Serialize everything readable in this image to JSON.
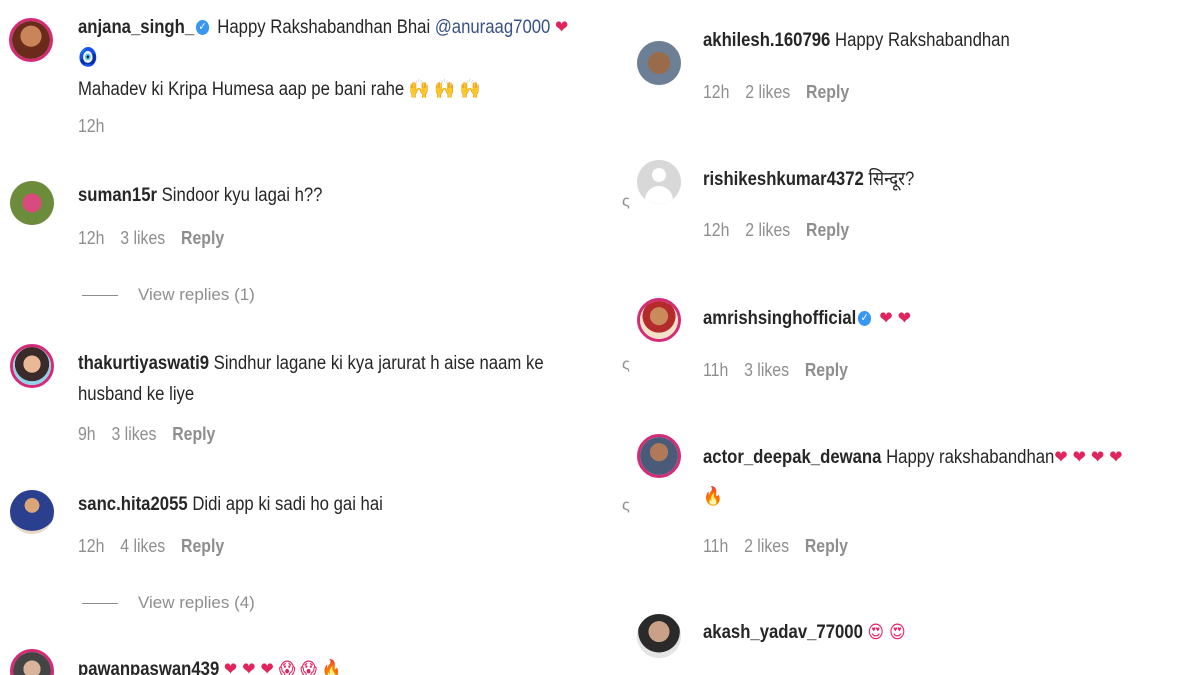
{
  "left": [
    {
      "user": "anjana_singh_",
      "verified": true,
      "text": "Happy Rakshabandhan Bhai ",
      "mention": "@anuraag7000",
      "emoji_after": "❤",
      "line2": "🧿",
      "line3": "Mahadev ki Kripa Humesa aap pe bani rahe 🙌 🙌 🙌",
      "time": "12h"
    },
    {
      "user": "suman15r",
      "text": "Sindoor kyu lagai h??",
      "time": "12h",
      "likes": "3 likes",
      "reply": "Reply",
      "view_replies": "View replies (1)"
    },
    {
      "user": "thakurtiyaswati9",
      "text": "Sindhur lagane ki kya jarurat h aise naam ke",
      "line2": "husband ke liye",
      "time": "9h",
      "likes": "3 likes",
      "reply": "Reply"
    },
    {
      "user": "sanc.hita2055",
      "text": "Didi app ki sadi ho gai hai",
      "time": "12h",
      "likes": "4 likes",
      "reply": "Reply",
      "view_replies": "View replies (4)"
    },
    {
      "user": "pawanpaswan439",
      "emojis": "❤ ❤ ❤ 😱 😱 🔥"
    }
  ],
  "right": [
    {
      "user": "akhilesh.160796",
      "text": "Happy Rakshabandhan",
      "time": "12h",
      "likes": "2 likes",
      "reply": "Reply"
    },
    {
      "user": "rishikeshkumar4372",
      "text": "सिन्दूर?",
      "time": "12h",
      "likes": "2 likes",
      "reply": "Reply"
    },
    {
      "user": "amrishsinghofficial",
      "verified": true,
      "emojis": "❤ ❤",
      "time": "11h",
      "likes": "3 likes",
      "reply": "Reply"
    },
    {
      "user": "actor_deepak_dewana",
      "text": "Happy rakshabandhan",
      "emojis": "❤ ❤ ❤ ❤",
      "line2": "🔥",
      "time": "11h",
      "likes": "2 likes",
      "reply": "Reply"
    },
    {
      "user": "akash_yadav_77000",
      "emojis": "😍 😍"
    }
  ]
}
